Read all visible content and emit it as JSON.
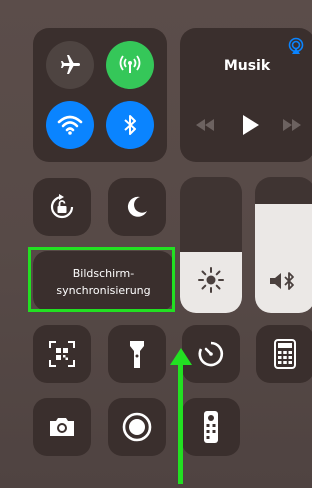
{
  "music": {
    "title": "Musik"
  },
  "screen_mirroring": {
    "line1": "Bildschirm-",
    "line2": "synchronisierung"
  },
  "sliders": {
    "brightness_level": 0.45,
    "volume_level": 0.8
  },
  "colors": {
    "highlight": "#22e022",
    "cellular_active": "#35c759",
    "wifi_active": "#0a84ff",
    "bluetooth_active": "#0a84ff"
  }
}
